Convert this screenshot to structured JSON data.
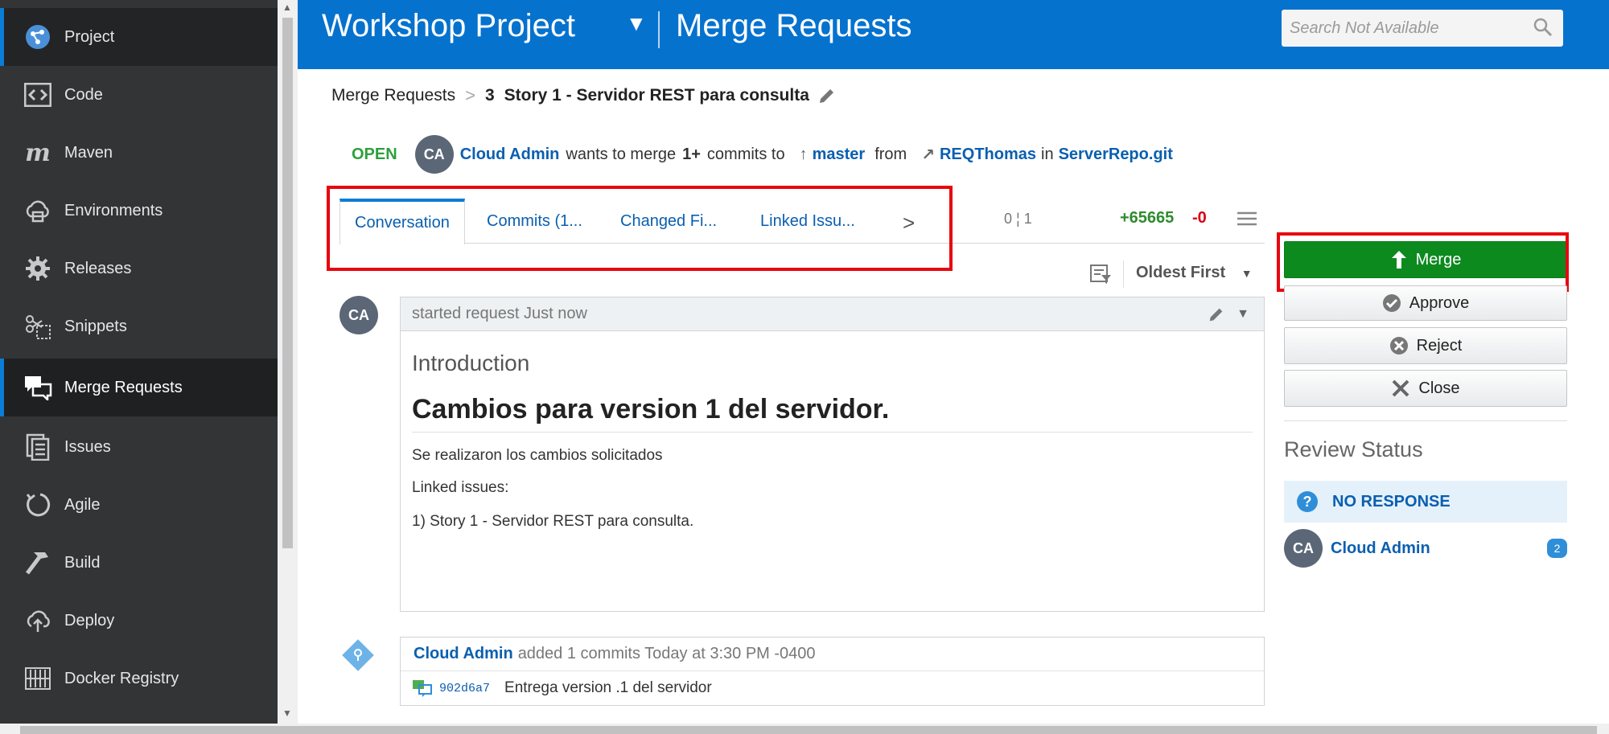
{
  "sidebar": {
    "items": [
      {
        "label": "Project",
        "icon": "project-icon"
      },
      {
        "label": "Code",
        "icon": "code-icon"
      },
      {
        "label": "Maven",
        "icon": "maven-icon"
      },
      {
        "label": "Environments",
        "icon": "environments-icon"
      },
      {
        "label": "Releases",
        "icon": "releases-icon"
      },
      {
        "label": "Snippets",
        "icon": "snippets-icon"
      },
      {
        "label": "Merge Requests",
        "icon": "merge-requests-icon"
      },
      {
        "label": "Issues",
        "icon": "issues-icon"
      },
      {
        "label": "Agile",
        "icon": "agile-icon"
      },
      {
        "label": "Build",
        "icon": "build-icon"
      },
      {
        "label": "Deploy",
        "icon": "deploy-icon"
      },
      {
        "label": "Docker Registry",
        "icon": "docker-registry-icon"
      }
    ],
    "active": "Merge Requests"
  },
  "header": {
    "project_name": "Workshop Project",
    "page_title": "Merge Requests",
    "search_placeholder": "Search Not Available"
  },
  "breadcrumb": {
    "root": "Merge Requests",
    "number": "3",
    "title": "Story 1 - Servidor REST para consulta"
  },
  "status": {
    "state": "OPEN",
    "avatar_initials": "CA",
    "author": "Cloud Admin",
    "text_wants": "wants to merge",
    "commit_count": "1+",
    "text_commits": "commits to",
    "target_branch": "master",
    "text_from": "from",
    "source_branch": "REQThomas",
    "text_in": "in",
    "repo": "ServerRepo.git"
  },
  "tabs": {
    "items": [
      "Conversation",
      "Commits (1...",
      "Changed Fi...",
      "Linked Issu..."
    ],
    "active": "Conversation",
    "scale": "0 ¦ 1",
    "additions": "+65665",
    "deletions": "-0"
  },
  "sort": {
    "selected": "Oldest First"
  },
  "comment": {
    "avatar_initials": "CA",
    "header": "started request Just now",
    "intro_heading": "Introduction",
    "main_heading": "Cambios para version 1 del servidor.",
    "paragraph_1": "Se realizaron los cambios solicitados",
    "paragraph_2": "Linked issues:",
    "paragraph_3": "1) Story 1 - Servidor REST para consulta."
  },
  "event": {
    "author": "Cloud Admin",
    "text": "added 1 commits Today at 3:30 PM -0400",
    "commit_hash": "902d6a7",
    "commit_message": "Entrega version .1 del servidor"
  },
  "actions": {
    "merge": "Merge",
    "approve": "Approve",
    "reject": "Reject",
    "close": "Close"
  },
  "review": {
    "title": "Review Status",
    "status": "NO RESPONSE",
    "reviewer_initials": "CA",
    "reviewer": "Cloud Admin",
    "count": "2"
  },
  "colors": {
    "header_blue": "#0572ce",
    "sidebar_bg": "#333436",
    "merge_green": "#0c8a1e",
    "highlight_red": "#e8050f",
    "open_green": "#2e9f3c"
  }
}
